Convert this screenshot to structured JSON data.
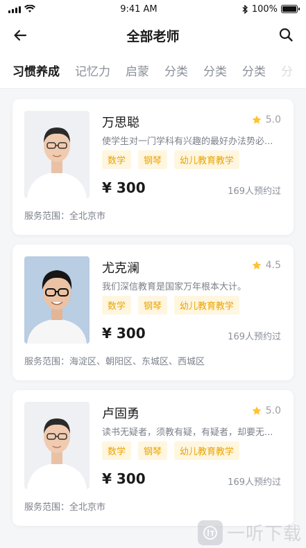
{
  "status_bar": {
    "time": "9:41 AM",
    "battery": "100%"
  },
  "header": {
    "title": "全部老师"
  },
  "tabs": [
    {
      "label": "习惯养成",
      "active": true
    },
    {
      "label": "记忆力"
    },
    {
      "label": "启蒙"
    },
    {
      "label": "分类"
    },
    {
      "label": "分类"
    },
    {
      "label": "分类"
    },
    {
      "label": "分"
    }
  ],
  "teachers": [
    {
      "name": "万思聪",
      "rating": "5.0",
      "desc": "使学生对一门学科有兴趣的最好办法势必...",
      "tags": [
        "数学",
        "钢琴",
        "幼儿教育教学"
      ],
      "price": "¥ 300",
      "booked": "169人预约过",
      "scope": "服务范围：全北京市"
    },
    {
      "name": "尤克澜",
      "rating": "4.5",
      "desc": "我们深信教育是国家万年根本大计。",
      "tags": [
        "数学",
        "钢琴",
        "幼儿教育教学"
      ],
      "price": "¥ 300",
      "booked": "169人预约过",
      "scope": "服务范围：海淀区、朝阳区、东城区、西城区"
    },
    {
      "name": "卢固勇",
      "rating": "5.0",
      "desc": "读书无疑者，须教有疑，有疑者，却要无...",
      "tags": [
        "数学",
        "钢琴",
        "幼儿教育教学"
      ],
      "price": "¥ 300",
      "booked": "169人预约过",
      "scope": "服务范围：全北京市"
    }
  ],
  "watermark": {
    "text": "一听下载"
  },
  "colors": {
    "accent": "#ffc233",
    "tag_bg": "#fff6e0",
    "tag_text": "#e9a400"
  }
}
